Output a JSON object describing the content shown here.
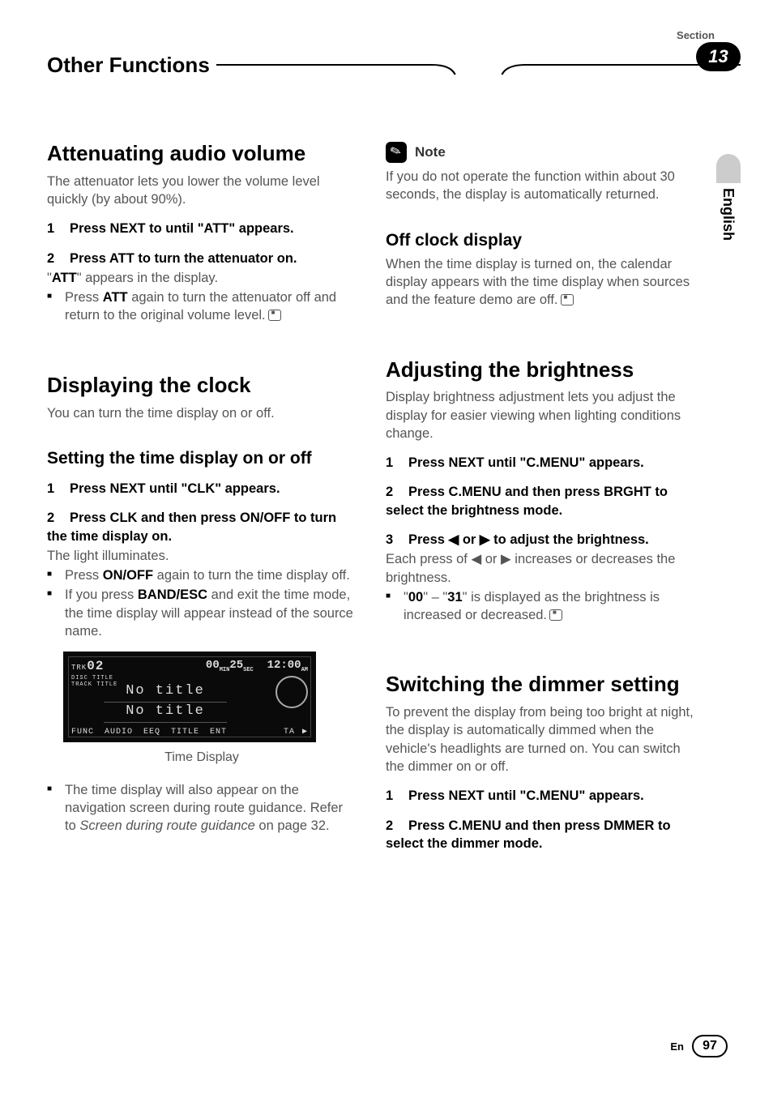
{
  "header": {
    "section_label": "Section",
    "title": "Other Functions",
    "section_number": "13",
    "language_tab": "English"
  },
  "left": {
    "sec1": {
      "title": "Attenuating audio volume",
      "intro": "The attenuator lets you lower the volume level quickly (by about 90%).",
      "step1": "Press NEXT to until \"ATT\" appears.",
      "step2": "Press ATT to turn the attenuator on.",
      "after2": "\"",
      "after2_bold": "ATT",
      "after2_rest": "\" appears in the display.",
      "bullet1_a": "Press ",
      "bullet1_bold": "ATT",
      "bullet1_b": " again to turn the attenuator off and return to the original volume level."
    },
    "sec2": {
      "title": "Displaying the clock",
      "intro": "You can turn the time display on or off.",
      "sub1": {
        "title": "Setting the time display on or off",
        "step1": "Press NEXT until \"CLK\" appears.",
        "step2": "Press CLK and then press ON/OFF to turn the time display on.",
        "after2": "The light illuminates.",
        "bullet1_a": "Press ",
        "bullet1_bold": "ON/OFF",
        "bullet1_b": " again to turn the time display off.",
        "bullet2_a": "If you press ",
        "bullet2_bold": "BAND/ESC",
        "bullet2_b": " and exit the time mode, the time display will appear instead of the source name.",
        "caption": "Time Display",
        "bullet3_a": "The time display will also appear on the navigation screen during route guidance. Refer to ",
        "bullet3_italic": "Screen during route guidance",
        "bullet3_b": " on page 32."
      }
    },
    "lcd": {
      "trk_label": "TRK",
      "trk_num": "02",
      "min": "00",
      "min_label": "MIN",
      "sec": "25",
      "sec_label": "SEC",
      "clock": "12:00",
      "ampm": "AM",
      "disc_title": "DISC TITLE",
      "track_title": "TRACK TITLE",
      "line1": "No title",
      "line2": "No title",
      "menu": "FUNC  AUDIO  EEQ  TITLE  ENT",
      "ta": "TA  ▶"
    }
  },
  "right": {
    "note": {
      "label": "Note",
      "body": "If you do not operate the function within about 30 seconds, the display is automatically returned."
    },
    "sec_off": {
      "title": "Off clock display",
      "body": "When the time display is turned on, the calendar display appears with the time display when sources and the feature demo are off."
    },
    "sec_bright": {
      "title": "Adjusting the brightness",
      "intro": "Display brightness adjustment lets you adjust the display for easier viewing when lighting conditions change.",
      "step1": "Press NEXT until \"C.MENU\" appears.",
      "step2": "Press C.MENU and then press BRGHT to select the brightness mode.",
      "step3": "Press ◀ or ▶ to adjust the brightness.",
      "after3": "Each press of ◀ or ▶ increases or decreases the brightness.",
      "bullet_a": "\"",
      "bullet_b1": "00",
      "bullet_mid": "\" – \"",
      "bullet_b2": "31",
      "bullet_c": "\" is displayed as the brightness is increased or decreased."
    },
    "sec_dim": {
      "title": "Switching the dimmer setting",
      "intro": "To prevent the display from being too bright at night, the display is automatically dimmed when the vehicle's headlights are turned on. You can switch the dimmer on or off.",
      "step1": "Press NEXT until \"C.MENU\" appears.",
      "step2": "Press C.MENU and then press DMMER to select the dimmer mode."
    }
  },
  "footer": {
    "lang": "En",
    "page": "97"
  }
}
